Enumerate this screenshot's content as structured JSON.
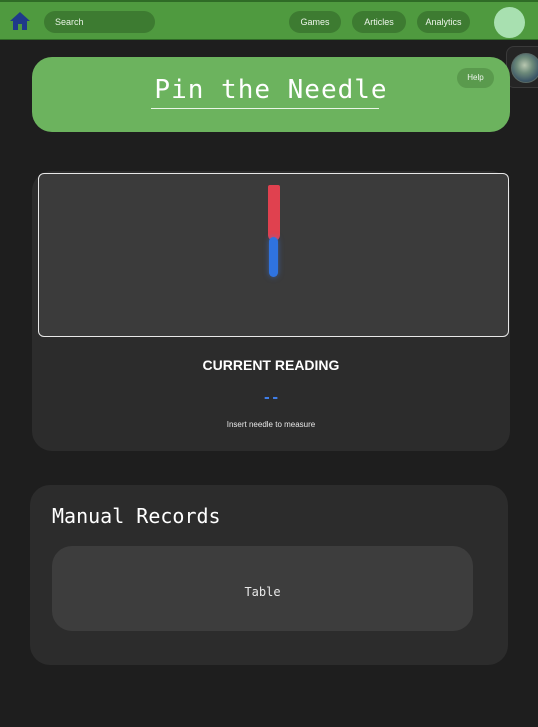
{
  "navbar": {
    "search_placeholder": "Search",
    "links": [
      "Games",
      "Articles",
      "Analytics"
    ]
  },
  "header": {
    "title": "Pin the Needle",
    "help_label": "Help"
  },
  "measurement": {
    "reading_label": "CURRENT READING",
    "reading_value": "--",
    "hint": "Insert needle to measure"
  },
  "records": {
    "title": "Manual Records",
    "table_label": "Table"
  },
  "colors": {
    "nav_green": "#4f9a3f",
    "title_green": "#6cb35e",
    "needle_red": "#e0414f",
    "needle_blue": "#2f73e0",
    "background": "#1e1e1e"
  },
  "icons": [
    "home-icon",
    "avatar",
    "thumbnail-image"
  ]
}
